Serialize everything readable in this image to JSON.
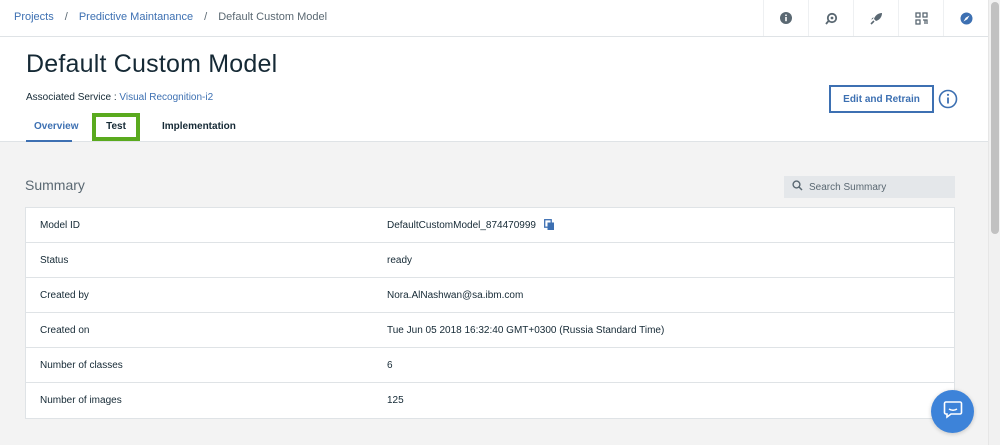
{
  "breadcrumb": {
    "items": [
      "Projects",
      "Predictive Maintanance"
    ],
    "current": "Default Custom Model",
    "separator": "/"
  },
  "top_icons": [
    "info-icon",
    "deploy-icon",
    "rocket-icon",
    "apps-grid-icon",
    "compass-icon"
  ],
  "header": {
    "title": "Default Custom Model",
    "associated_label": "Associated Service :",
    "associated_link": "Visual Recognition-i2",
    "edit_button": "Edit and Retrain",
    "tabs": [
      {
        "label": "Overview",
        "active": true
      },
      {
        "label": "Test",
        "active": false,
        "highlighted": true
      },
      {
        "label": "Implementation",
        "active": false
      }
    ]
  },
  "summary": {
    "title": "Summary",
    "search_placeholder": "Search Summary",
    "rows": [
      {
        "label": "Model ID",
        "value": "DefaultCustomModel_874470999"
      },
      {
        "label": "Status",
        "value": "ready"
      },
      {
        "label": "Created by",
        "value": "Nora.AlNashwan@sa.ibm.com"
      },
      {
        "label": "Created on",
        "value": "Tue Jun 05 2018 16:32:40 GMT+0300 (Russia Standard Time)"
      },
      {
        "label": "Number of classes",
        "value": "6"
      },
      {
        "label": "Number of images",
        "value": "125"
      }
    ]
  },
  "colors": {
    "accent": "#3d70b2",
    "highlight": "#5aaa1e",
    "chat": "#3d83d9"
  }
}
